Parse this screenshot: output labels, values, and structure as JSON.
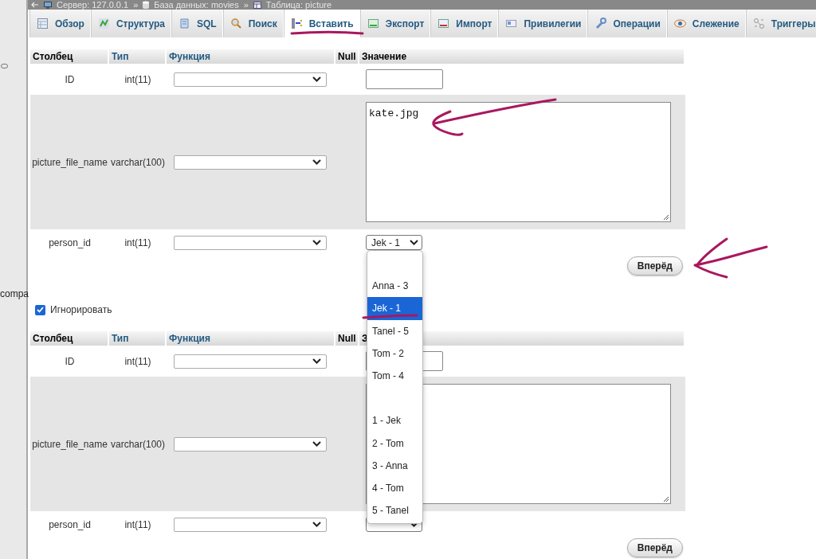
{
  "breadcrumb": {
    "separator": "»",
    "items": [
      {
        "label": "Сервер: 127.0.0.1"
      },
      {
        "label": "База данных: movies"
      },
      {
        "label": "Таблица: picture"
      }
    ]
  },
  "sidebar": {
    "text": "compa"
  },
  "tabs": [
    {
      "label": "Обзор",
      "selected": false
    },
    {
      "label": "Структура",
      "selected": false
    },
    {
      "label": "SQL",
      "selected": false
    },
    {
      "label": "Поиск",
      "selected": false
    },
    {
      "label": "Вставить",
      "selected": true
    },
    {
      "label": "Экспорт",
      "selected": false
    },
    {
      "label": "Импорт",
      "selected": false
    },
    {
      "label": "Привилегии",
      "selected": false
    },
    {
      "label": "Операции",
      "selected": false
    },
    {
      "label": "Слежение",
      "selected": false
    },
    {
      "label": "Триггеры",
      "selected": false
    }
  ],
  "records": [
    {
      "headers": {
        "column": "Столбец",
        "type": "Тип",
        "function": "Функция",
        "null": "Null",
        "value": "Значение"
      },
      "rows": [
        {
          "column": "ID",
          "type": "int(11)",
          "kind": "input"
        },
        {
          "column": "picture_file_name",
          "type": "varchar(100)",
          "kind": "textarea",
          "value": "kate.jpg"
        },
        {
          "column": "person_id",
          "type": "int(11)",
          "kind": "select",
          "value": "Jek - 1",
          "options": [
            {
              "kind": "blank",
              "selected": false
            },
            {
              "kind": "option",
              "label": "Anna - 3",
              "selected": false
            },
            {
              "kind": "option",
              "label": "Jek - 1",
              "selected": true
            },
            {
              "kind": "option",
              "label": "Tanel - 5",
              "selected": false
            },
            {
              "kind": "option",
              "label": "Tom - 2",
              "selected": false
            },
            {
              "kind": "option",
              "label": "Tom - 4",
              "selected": false
            },
            {
              "kind": "blank",
              "selected": false
            },
            {
              "kind": "option",
              "label": "1 - Jek",
              "selected": false
            },
            {
              "kind": "option",
              "label": "2 - Tom",
              "selected": false
            },
            {
              "kind": "option",
              "label": "3 - Anna",
              "selected": false
            },
            {
              "kind": "option",
              "label": "4 - Tom",
              "selected": false
            },
            {
              "kind": "option",
              "label": "5 - Tanel",
              "selected": false
            }
          ]
        }
      ],
      "go_button": "Вперёд"
    },
    {
      "headers": {
        "column": "Столбец",
        "type": "Тип",
        "function": "Функция",
        "null": "Null",
        "value": "З"
      },
      "rows": [
        {
          "column": "ID",
          "type": "int(11)",
          "kind": "input"
        },
        {
          "column": "picture_file_name",
          "type": "varchar(100)",
          "kind": "textarea"
        },
        {
          "column": "person_id",
          "type": "int(11)",
          "kind": "select"
        }
      ],
      "go_button": "Вперёд"
    }
  ],
  "ignore": {
    "label": "Игнорировать",
    "checked": true
  }
}
